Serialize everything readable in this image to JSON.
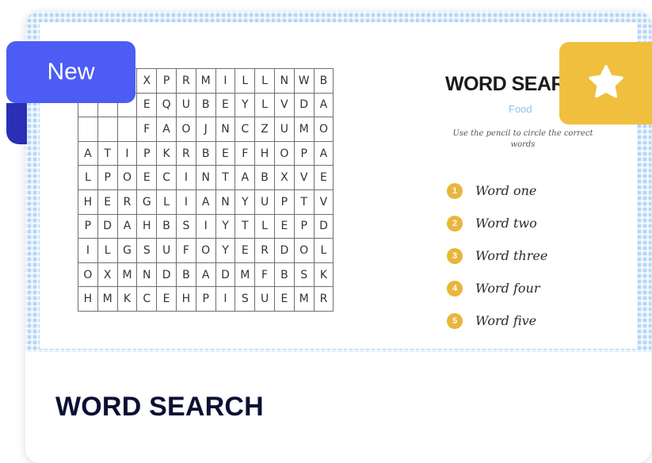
{
  "card": {
    "title": "WORD SEARCH",
    "badge_new": "New",
    "star_icon": "star-icon"
  },
  "worksheet": {
    "title": "WORD SEAR",
    "subtitle": "Food",
    "instructions": "Use the pencil to circle the correct words",
    "grid": [
      [
        "",
        "",
        "X",
        "P",
        "R",
        "M",
        "I",
        "L",
        "L",
        "N",
        "W",
        "B"
      ],
      [
        "",
        "",
        "E",
        "Q",
        "U",
        "B",
        "E",
        "Y",
        "L",
        "V",
        "D",
        "A"
      ],
      [
        "",
        "",
        "F",
        "A",
        "O",
        "J",
        "N",
        "C",
        "Z",
        "U",
        "M",
        "O"
      ],
      [
        "A",
        "T",
        "I",
        "P",
        "K",
        "R",
        "B",
        "E",
        "F",
        "H",
        "O",
        "P",
        "A"
      ],
      [
        "L",
        "P",
        "O",
        "E",
        "C",
        "I",
        "N",
        "T",
        "A",
        "B",
        "X",
        "V",
        "E"
      ],
      [
        "H",
        "E",
        "R",
        "G",
        "L",
        "I",
        "A",
        "N",
        "Y",
        "U",
        "P",
        "T",
        "V"
      ],
      [
        "P",
        "D",
        "A",
        "H",
        "B",
        "S",
        "I",
        "Y",
        "T",
        "L",
        "E",
        "P",
        "D"
      ],
      [
        "I",
        "L",
        "G",
        "S",
        "U",
        "F",
        "O",
        "Y",
        "E",
        "R",
        "D",
        "O",
        "L"
      ],
      [
        "O",
        "X",
        "M",
        "N",
        "D",
        "B",
        "A",
        "D",
        "M",
        "F",
        "B",
        "S",
        "K"
      ],
      [
        "H",
        "M",
        "K",
        "C",
        "E",
        "H",
        "P",
        "I",
        "S",
        "U",
        "E",
        "M",
        "R"
      ]
    ],
    "words": [
      {
        "num": "1",
        "text": "Word one"
      },
      {
        "num": "2",
        "text": "Word two"
      },
      {
        "num": "3",
        "text": "Word three"
      },
      {
        "num": "4",
        "text": "Word four"
      },
      {
        "num": "5",
        "text": "Word five"
      }
    ]
  },
  "colors": {
    "badge_new": "#4c5cf4",
    "badge_star": "#f0bf3e",
    "number_circle": "#e9b53c",
    "pattern": "#b3d6f5"
  }
}
